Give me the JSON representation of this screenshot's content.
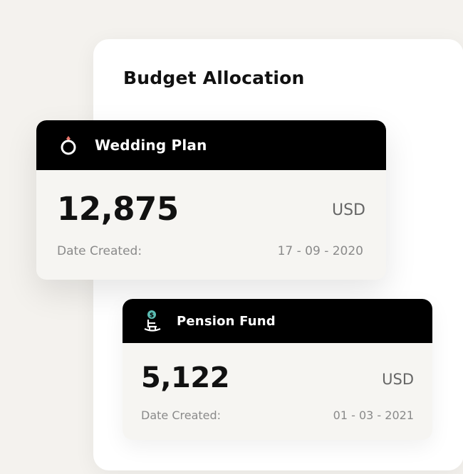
{
  "panel": {
    "title": "Budget Allocation"
  },
  "cards": [
    {
      "title": "Wedding Plan",
      "icon": "ring-icon",
      "amount": "12,875",
      "currency": "USD",
      "date_label": "Date Created:",
      "date_value": "17 - 09 - 2020"
    },
    {
      "title": "Pension Fund",
      "icon": "rocking-chair-icon",
      "amount": "5,122",
      "currency": "USD",
      "date_label": "Date Created:",
      "date_value": "01 - 03 - 2021"
    }
  ],
  "colors": {
    "background": "#f4f2ee",
    "panel": "#ffffff",
    "card": "#f6f5f2",
    "card_header": "#000000",
    "ring_gem": "#e8756a",
    "coin": "#5bbdb3"
  }
}
